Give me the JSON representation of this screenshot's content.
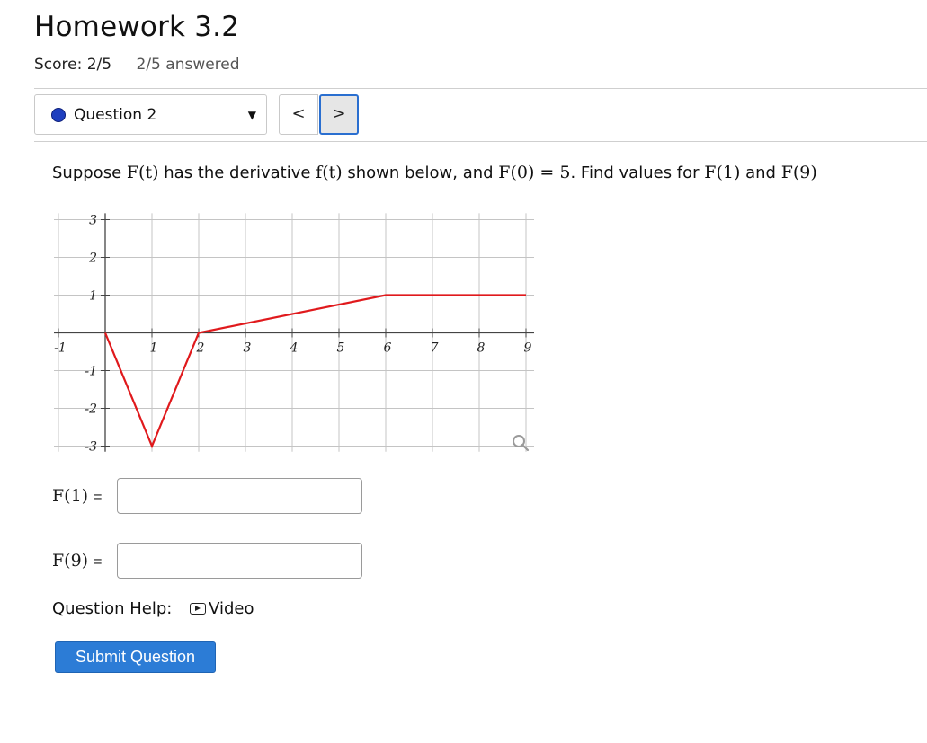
{
  "header": {
    "title": "Homework 3.2",
    "score": "Score: 2/5",
    "answered": "2/5 answered"
  },
  "question_nav": {
    "selected": "Question 2",
    "prev_label": "<",
    "next_label": ">",
    "status_color": "#1f3fbf"
  },
  "prompt": {
    "p1": "Suppose ",
    "F_t": "F(t)",
    "p2": " has the derivative ",
    "f_t": "f(t)",
    "p3": " shown below, and ",
    "F0": "F(0) = 5",
    "p4": ". Find values for ",
    "F1": "F(1)",
    "p5": " and ",
    "F9": "F(9)"
  },
  "chart_data": {
    "type": "line",
    "xlim": [
      -1,
      9
    ],
    "ylim": [
      -3,
      3
    ],
    "x_ticks": [
      "-1",
      "1",
      "2",
      "3",
      "4",
      "5",
      "6",
      "7",
      "8",
      "9"
    ],
    "y_ticks": [
      "3",
      "2",
      "1",
      "-1",
      "-2",
      "-3"
    ],
    "grid": true,
    "series": [
      {
        "color": "#e0191c",
        "x": [
          0,
          1,
          2,
          6,
          9
        ],
        "y": [
          0,
          -3,
          0,
          1,
          1
        ]
      }
    ]
  },
  "answers": [
    {
      "label": "F(1)",
      "eq": "=",
      "value": ""
    },
    {
      "label": "F(9)",
      "eq": "=",
      "value": ""
    }
  ],
  "help": {
    "label": "Question Help:",
    "video": "Video"
  },
  "submit_label": "Submit Question"
}
